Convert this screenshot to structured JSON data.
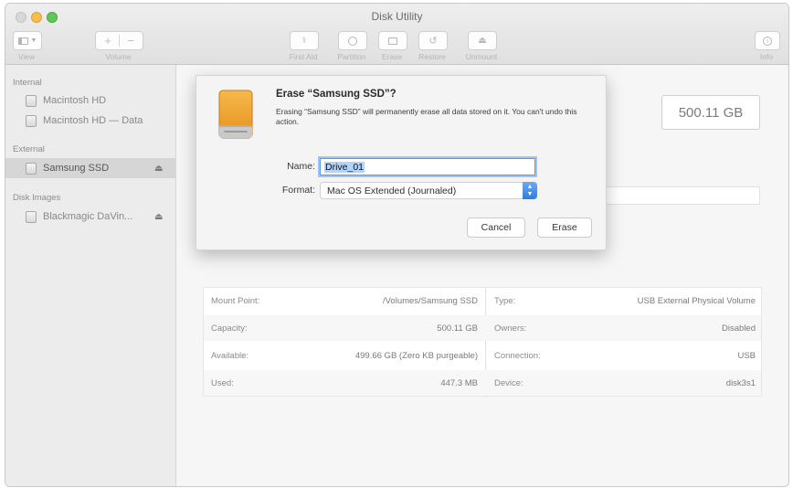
{
  "window": {
    "title": "Disk Utility"
  },
  "toolbar": {
    "view_label": "View",
    "volume_label": "Volume",
    "actions": [
      {
        "icon": "first-aid-icon",
        "label": "First Aid"
      },
      {
        "icon": "partition-icon",
        "label": "Partition"
      },
      {
        "icon": "erase-icon",
        "label": "Erase"
      },
      {
        "icon": "restore-icon",
        "label": "Restore"
      },
      {
        "icon": "unmount-icon",
        "label": "Unmount"
      }
    ],
    "info_label": "Info"
  },
  "sidebar": {
    "sections": [
      {
        "header": "Internal",
        "items": [
          "Macintosh HD",
          "Macintosh HD — Data"
        ]
      },
      {
        "header": "External",
        "items": [
          "Samsung SSD"
        ]
      },
      {
        "header": "Disk Images",
        "items": [
          "Blackmagic DaVin..."
        ]
      }
    ],
    "selected": "Samsung SSD"
  },
  "main": {
    "capacity_display": "500.11 GB",
    "info_rows": [
      {
        "left_key": "Mount Point:",
        "left_value": "/Volumes/Samsung SSD",
        "right_key": "Type:",
        "right_value": "USB External Physical Volume"
      },
      {
        "left_key": "Capacity:",
        "left_value": "500.11 GB",
        "right_key": "Owners:",
        "right_value": "Disabled"
      },
      {
        "left_key": "Available:",
        "left_value": "499.66 GB (Zero KB purgeable)",
        "right_key": "Connection:",
        "right_value": "USB"
      },
      {
        "left_key": "Used:",
        "left_value": "447.3 MB",
        "right_key": "Device:",
        "right_value": "disk3s1"
      }
    ]
  },
  "dialog": {
    "title": "Erase “Samsung SSD”?",
    "message": "Erasing “Samsung SSD” will permanently erase all data stored on it. You can't undo this action.",
    "name_label": "Name:",
    "name_value": "Drive_01",
    "format_label": "Format:",
    "format_value": "Mac OS Extended (Journaled)",
    "cancel_label": "Cancel",
    "erase_label": "Erase"
  },
  "colors": {
    "accent": "#3b82e6",
    "drive_orange": "#f0a030"
  }
}
